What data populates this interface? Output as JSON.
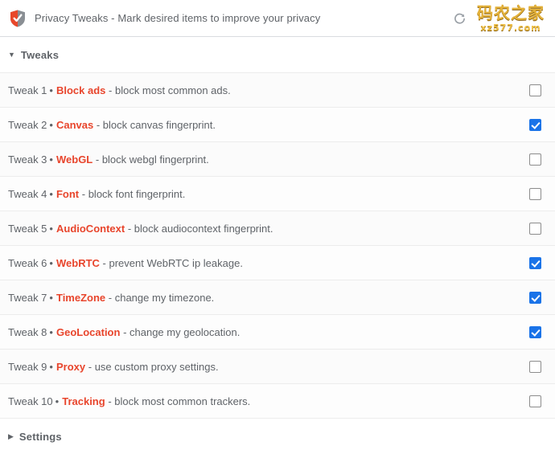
{
  "header": {
    "icon": "shield-check-icon",
    "title": "Privacy Tweaks - Mark desired items to improve your privacy",
    "reload_icon": "reload-icon",
    "watermark_cn": "码农之家",
    "watermark_url": "xz577.com",
    "accent_color": "#e8452c",
    "checked_color": "#1a73e8"
  },
  "sections": {
    "tweaks": {
      "label": "Tweaks",
      "disclosure": "▼",
      "expanded": true
    },
    "settings": {
      "label": "Settings",
      "disclosure": "▶",
      "expanded": false
    }
  },
  "tweaks": [
    {
      "index": "Tweak 1",
      "bullet": "•",
      "name": "Block ads",
      "desc": "- block most common ads.",
      "checked": false
    },
    {
      "index": "Tweak 2",
      "bullet": "•",
      "name": "Canvas",
      "desc": "- block canvas fingerprint.",
      "checked": true
    },
    {
      "index": "Tweak 3",
      "bullet": "•",
      "name": "WebGL",
      "desc": "- block webgl fingerprint.",
      "checked": false
    },
    {
      "index": "Tweak 4",
      "bullet": "•",
      "name": "Font",
      "desc": "- block font fingerprint.",
      "checked": false
    },
    {
      "index": "Tweak 5",
      "bullet": "•",
      "name": "AudioContext",
      "desc": "- block audiocontext fingerprint.",
      "checked": false
    },
    {
      "index": "Tweak 6",
      "bullet": "•",
      "name": "WebRTC",
      "desc": "- prevent WebRTC ip leakage.",
      "checked": true
    },
    {
      "index": "Tweak 7",
      "bullet": "•",
      "name": "TimeZone",
      "desc": "- change my timezone.",
      "checked": true
    },
    {
      "index": "Tweak 8",
      "bullet": "•",
      "name": "GeoLocation",
      "desc": "- change my geolocation.",
      "checked": true
    },
    {
      "index": "Tweak 9",
      "bullet": "•",
      "name": "Proxy",
      "desc": "- use custom proxy settings.",
      "checked": false
    },
    {
      "index": "Tweak 10",
      "bullet": "•",
      "name": "Tracking",
      "desc": "- block most common trackers.",
      "checked": false
    }
  ]
}
